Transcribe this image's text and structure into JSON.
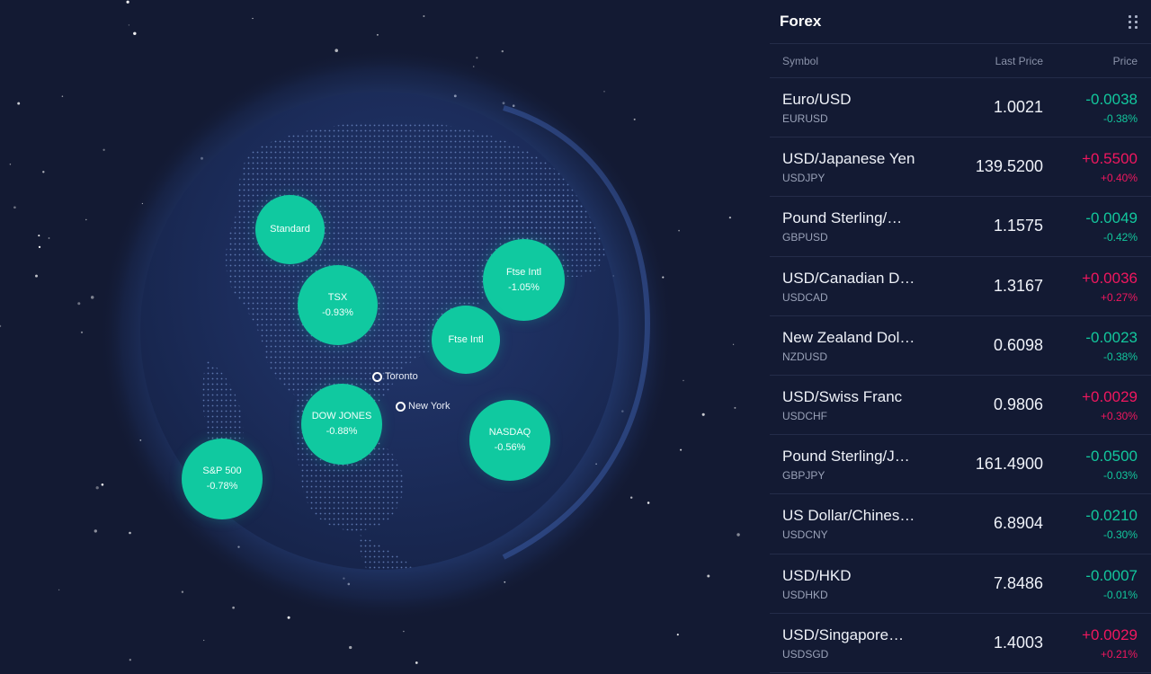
{
  "map": {
    "bubbles": [
      {
        "name": "Standard",
        "change": ""
      },
      {
        "name": "TSX",
        "change": "-0.93%"
      },
      {
        "name": "Ftse Intl",
        "change": "-1.05%"
      },
      {
        "name": "Ftse Intl",
        "change": ""
      },
      {
        "name": "DOW JONES",
        "change": "-0.88%"
      },
      {
        "name": "NASDAQ",
        "change": "-0.56%"
      },
      {
        "name": "S&P 500",
        "change": "-0.78%"
      }
    ],
    "cities": [
      {
        "name": "Toronto"
      },
      {
        "name": "New York"
      }
    ]
  },
  "forex": {
    "title": "Forex",
    "menu_icon": "drag-dots-icon",
    "columns": {
      "symbol": "Symbol",
      "last_price": "Last Price",
      "price": "Price"
    },
    "rows": [
      {
        "name": "Euro/USD",
        "code": "EURUSD",
        "last": "1.0021",
        "change": "-0.0038",
        "pct": "-0.38%",
        "direction": "down"
      },
      {
        "name": "USD/Japanese Yen",
        "code": "USDJPY",
        "last": "139.5200",
        "change": "+0.5500",
        "pct": "+0.40%",
        "direction": "up"
      },
      {
        "name": "Pound Sterling/…",
        "code": "GBPUSD",
        "last": "1.1575",
        "change": "-0.0049",
        "pct": "-0.42%",
        "direction": "down"
      },
      {
        "name": "USD/Canadian D…",
        "code": "USDCAD",
        "last": "1.3167",
        "change": "+0.0036",
        "pct": "+0.27%",
        "direction": "up"
      },
      {
        "name": "New Zealand Dol…",
        "code": "NZDUSD",
        "last": "0.6098",
        "change": "-0.0023",
        "pct": "-0.38%",
        "direction": "down"
      },
      {
        "name": "USD/Swiss Franc",
        "code": "USDCHF",
        "last": "0.9806",
        "change": "+0.0029",
        "pct": "+0.30%",
        "direction": "up"
      },
      {
        "name": "Pound Sterling/J…",
        "code": "GBPJPY",
        "last": "161.4900",
        "change": "-0.0500",
        "pct": "-0.03%",
        "direction": "down"
      },
      {
        "name": "US Dollar/Chines…",
        "code": "USDCNY",
        "last": "6.8904",
        "change": "-0.0210",
        "pct": "-0.30%",
        "direction": "down"
      },
      {
        "name": "USD/HKD",
        "code": "USDHKD",
        "last": "7.8486",
        "change": "-0.0007",
        "pct": "-0.01%",
        "direction": "down"
      },
      {
        "name": "USD/Singapore…",
        "code": "USDSGD",
        "last": "1.4003",
        "change": "+0.0029",
        "pct": "+0.21%",
        "direction": "up"
      }
    ]
  },
  "colors": {
    "background": "#131a33",
    "bubble": "#10c9a0",
    "negative": "#12c79d",
    "positive": "#f0175f"
  }
}
